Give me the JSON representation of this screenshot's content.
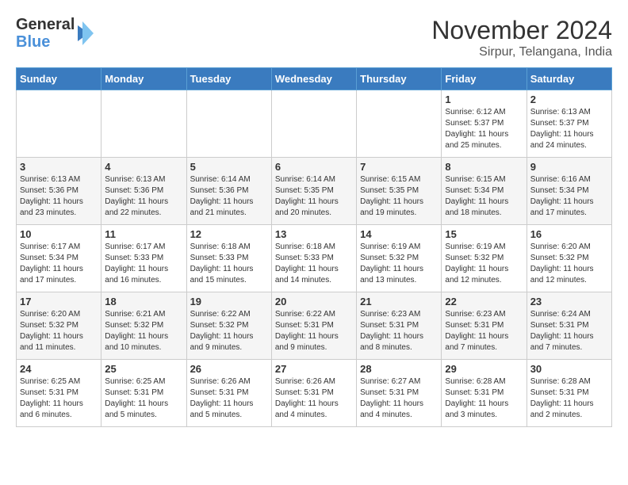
{
  "logo": {
    "text_general": "General",
    "text_blue": "Blue"
  },
  "title": "November 2024",
  "location": "Sirpur, Telangana, India",
  "days_of_week": [
    "Sunday",
    "Monday",
    "Tuesday",
    "Wednesday",
    "Thursday",
    "Friday",
    "Saturday"
  ],
  "weeks": [
    [
      {
        "day": "",
        "info": ""
      },
      {
        "day": "",
        "info": ""
      },
      {
        "day": "",
        "info": ""
      },
      {
        "day": "",
        "info": ""
      },
      {
        "day": "",
        "info": ""
      },
      {
        "day": "1",
        "info": "Sunrise: 6:12 AM\nSunset: 5:37 PM\nDaylight: 11 hours and 25 minutes."
      },
      {
        "day": "2",
        "info": "Sunrise: 6:13 AM\nSunset: 5:37 PM\nDaylight: 11 hours and 24 minutes."
      }
    ],
    [
      {
        "day": "3",
        "info": "Sunrise: 6:13 AM\nSunset: 5:36 PM\nDaylight: 11 hours and 23 minutes."
      },
      {
        "day": "4",
        "info": "Sunrise: 6:13 AM\nSunset: 5:36 PM\nDaylight: 11 hours and 22 minutes."
      },
      {
        "day": "5",
        "info": "Sunrise: 6:14 AM\nSunset: 5:36 PM\nDaylight: 11 hours and 21 minutes."
      },
      {
        "day": "6",
        "info": "Sunrise: 6:14 AM\nSunset: 5:35 PM\nDaylight: 11 hours and 20 minutes."
      },
      {
        "day": "7",
        "info": "Sunrise: 6:15 AM\nSunset: 5:35 PM\nDaylight: 11 hours and 19 minutes."
      },
      {
        "day": "8",
        "info": "Sunrise: 6:15 AM\nSunset: 5:34 PM\nDaylight: 11 hours and 18 minutes."
      },
      {
        "day": "9",
        "info": "Sunrise: 6:16 AM\nSunset: 5:34 PM\nDaylight: 11 hours and 17 minutes."
      }
    ],
    [
      {
        "day": "10",
        "info": "Sunrise: 6:17 AM\nSunset: 5:34 PM\nDaylight: 11 hours and 17 minutes."
      },
      {
        "day": "11",
        "info": "Sunrise: 6:17 AM\nSunset: 5:33 PM\nDaylight: 11 hours and 16 minutes."
      },
      {
        "day": "12",
        "info": "Sunrise: 6:18 AM\nSunset: 5:33 PM\nDaylight: 11 hours and 15 minutes."
      },
      {
        "day": "13",
        "info": "Sunrise: 6:18 AM\nSunset: 5:33 PM\nDaylight: 11 hours and 14 minutes."
      },
      {
        "day": "14",
        "info": "Sunrise: 6:19 AM\nSunset: 5:32 PM\nDaylight: 11 hours and 13 minutes."
      },
      {
        "day": "15",
        "info": "Sunrise: 6:19 AM\nSunset: 5:32 PM\nDaylight: 11 hours and 12 minutes."
      },
      {
        "day": "16",
        "info": "Sunrise: 6:20 AM\nSunset: 5:32 PM\nDaylight: 11 hours and 12 minutes."
      }
    ],
    [
      {
        "day": "17",
        "info": "Sunrise: 6:20 AM\nSunset: 5:32 PM\nDaylight: 11 hours and 11 minutes."
      },
      {
        "day": "18",
        "info": "Sunrise: 6:21 AM\nSunset: 5:32 PM\nDaylight: 11 hours and 10 minutes."
      },
      {
        "day": "19",
        "info": "Sunrise: 6:22 AM\nSunset: 5:32 PM\nDaylight: 11 hours and 9 minutes."
      },
      {
        "day": "20",
        "info": "Sunrise: 6:22 AM\nSunset: 5:31 PM\nDaylight: 11 hours and 9 minutes."
      },
      {
        "day": "21",
        "info": "Sunrise: 6:23 AM\nSunset: 5:31 PM\nDaylight: 11 hours and 8 minutes."
      },
      {
        "day": "22",
        "info": "Sunrise: 6:23 AM\nSunset: 5:31 PM\nDaylight: 11 hours and 7 minutes."
      },
      {
        "day": "23",
        "info": "Sunrise: 6:24 AM\nSunset: 5:31 PM\nDaylight: 11 hours and 7 minutes."
      }
    ],
    [
      {
        "day": "24",
        "info": "Sunrise: 6:25 AM\nSunset: 5:31 PM\nDaylight: 11 hours and 6 minutes."
      },
      {
        "day": "25",
        "info": "Sunrise: 6:25 AM\nSunset: 5:31 PM\nDaylight: 11 hours and 5 minutes."
      },
      {
        "day": "26",
        "info": "Sunrise: 6:26 AM\nSunset: 5:31 PM\nDaylight: 11 hours and 5 minutes."
      },
      {
        "day": "27",
        "info": "Sunrise: 6:26 AM\nSunset: 5:31 PM\nDaylight: 11 hours and 4 minutes."
      },
      {
        "day": "28",
        "info": "Sunrise: 6:27 AM\nSunset: 5:31 PM\nDaylight: 11 hours and 4 minutes."
      },
      {
        "day": "29",
        "info": "Sunrise: 6:28 AM\nSunset: 5:31 PM\nDaylight: 11 hours and 3 minutes."
      },
      {
        "day": "30",
        "info": "Sunrise: 6:28 AM\nSunset: 5:31 PM\nDaylight: 11 hours and 2 minutes."
      }
    ]
  ]
}
